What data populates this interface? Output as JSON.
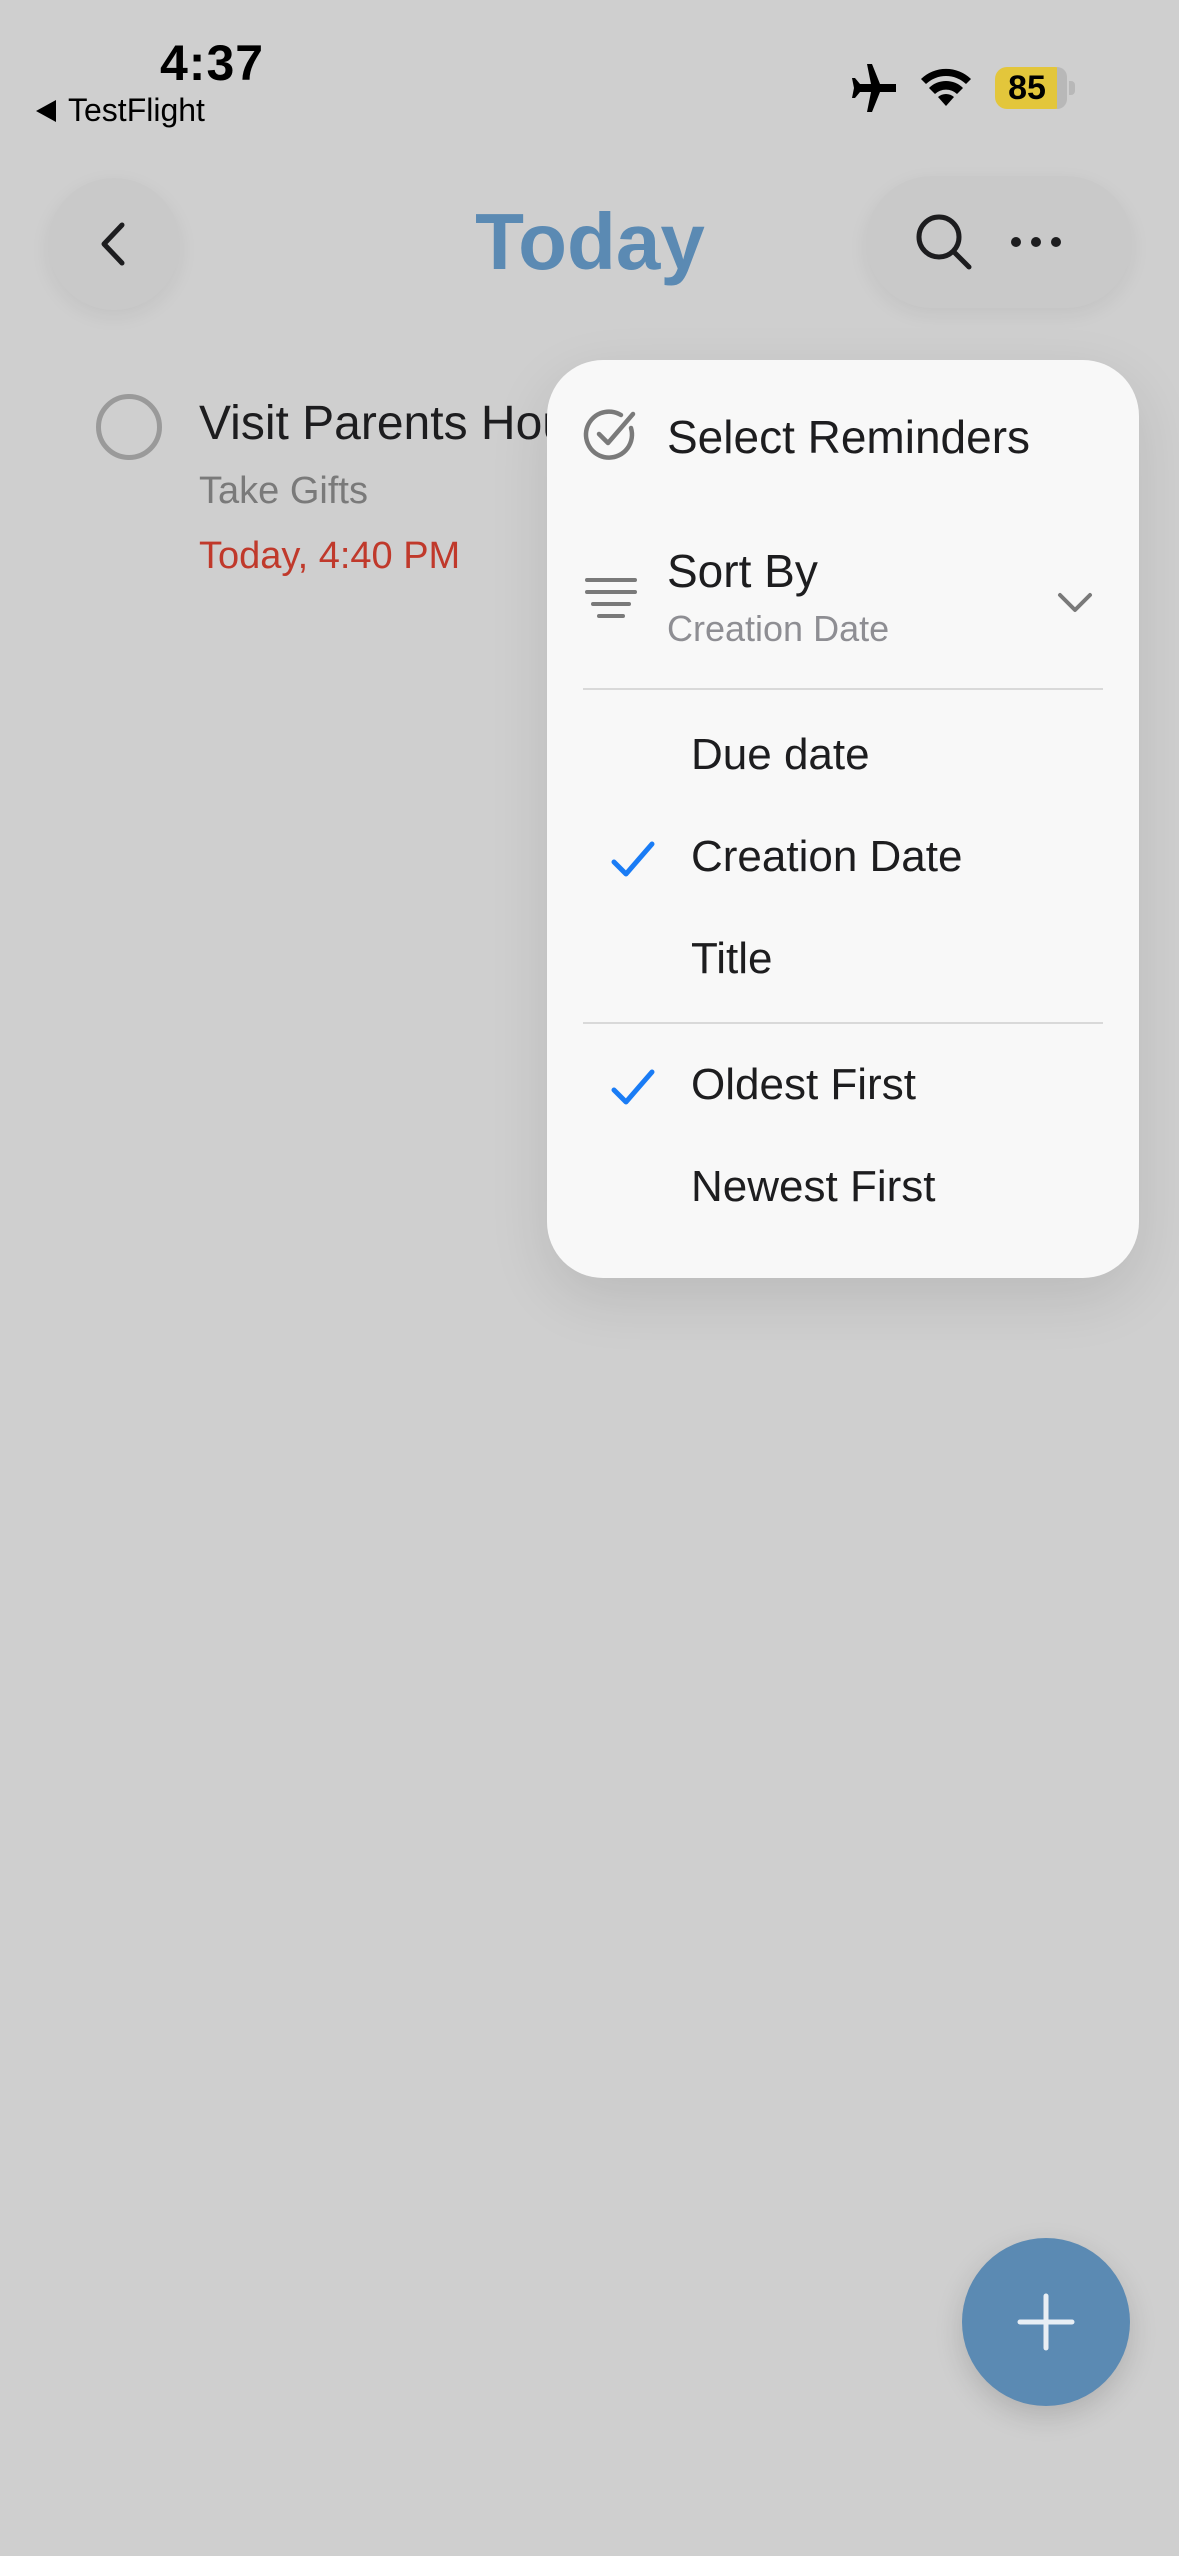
{
  "status_bar": {
    "time": "4:37",
    "back_app": "TestFlight",
    "battery": "85",
    "icons": [
      "airplane-icon",
      "wifi-icon",
      "battery-icon"
    ]
  },
  "nav": {
    "title": "Today",
    "back_icon": "chevron-left-icon",
    "search_icon": "search-icon",
    "more_icon": "ellipsis-icon"
  },
  "reminder": {
    "title": "Visit Parents House",
    "visible_title": "Visit Parents Hou",
    "notes": "Take Gifts",
    "due": "Today, 4:40 PM"
  },
  "menu": {
    "select_label": "Select Reminders",
    "sort_by_label": "Sort By",
    "sort_by_value": "Creation Date",
    "sort_options": [
      {
        "label": "Due date",
        "checked": false
      },
      {
        "label": "Creation Date",
        "checked": true
      },
      {
        "label": "Title",
        "checked": false
      }
    ],
    "order_options": [
      {
        "label": "Oldest First",
        "checked": true
      },
      {
        "label": "Newest First",
        "checked": false
      }
    ]
  },
  "colors": {
    "accent": "#5b8ab3",
    "check": "#1a7cf5",
    "due": "#c0392b",
    "battery": "#e3c63b"
  },
  "fab": {
    "icon": "plus-icon"
  }
}
